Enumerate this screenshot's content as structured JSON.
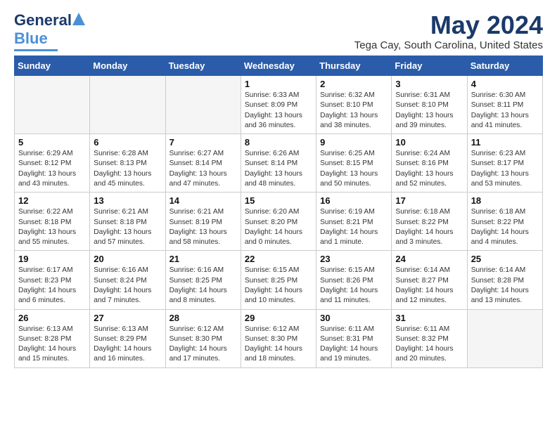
{
  "header": {
    "logo_general": "General",
    "logo_blue": "Blue",
    "month_title": "May 2024",
    "location": "Tega Cay, South Carolina, United States"
  },
  "days_of_week": [
    "Sunday",
    "Monday",
    "Tuesday",
    "Wednesday",
    "Thursday",
    "Friday",
    "Saturday"
  ],
  "weeks": [
    [
      {
        "day": "",
        "info": ""
      },
      {
        "day": "",
        "info": ""
      },
      {
        "day": "",
        "info": ""
      },
      {
        "day": "1",
        "info": "Sunrise: 6:33 AM\nSunset: 8:09 PM\nDaylight: 13 hours\nand 36 minutes."
      },
      {
        "day": "2",
        "info": "Sunrise: 6:32 AM\nSunset: 8:10 PM\nDaylight: 13 hours\nand 38 minutes."
      },
      {
        "day": "3",
        "info": "Sunrise: 6:31 AM\nSunset: 8:10 PM\nDaylight: 13 hours\nand 39 minutes."
      },
      {
        "day": "4",
        "info": "Sunrise: 6:30 AM\nSunset: 8:11 PM\nDaylight: 13 hours\nand 41 minutes."
      }
    ],
    [
      {
        "day": "5",
        "info": "Sunrise: 6:29 AM\nSunset: 8:12 PM\nDaylight: 13 hours\nand 43 minutes."
      },
      {
        "day": "6",
        "info": "Sunrise: 6:28 AM\nSunset: 8:13 PM\nDaylight: 13 hours\nand 45 minutes."
      },
      {
        "day": "7",
        "info": "Sunrise: 6:27 AM\nSunset: 8:14 PM\nDaylight: 13 hours\nand 47 minutes."
      },
      {
        "day": "8",
        "info": "Sunrise: 6:26 AM\nSunset: 8:14 PM\nDaylight: 13 hours\nand 48 minutes."
      },
      {
        "day": "9",
        "info": "Sunrise: 6:25 AM\nSunset: 8:15 PM\nDaylight: 13 hours\nand 50 minutes."
      },
      {
        "day": "10",
        "info": "Sunrise: 6:24 AM\nSunset: 8:16 PM\nDaylight: 13 hours\nand 52 minutes."
      },
      {
        "day": "11",
        "info": "Sunrise: 6:23 AM\nSunset: 8:17 PM\nDaylight: 13 hours\nand 53 minutes."
      }
    ],
    [
      {
        "day": "12",
        "info": "Sunrise: 6:22 AM\nSunset: 8:18 PM\nDaylight: 13 hours\nand 55 minutes."
      },
      {
        "day": "13",
        "info": "Sunrise: 6:21 AM\nSunset: 8:18 PM\nDaylight: 13 hours\nand 57 minutes."
      },
      {
        "day": "14",
        "info": "Sunrise: 6:21 AM\nSunset: 8:19 PM\nDaylight: 13 hours\nand 58 minutes."
      },
      {
        "day": "15",
        "info": "Sunrise: 6:20 AM\nSunset: 8:20 PM\nDaylight: 14 hours\nand 0 minutes."
      },
      {
        "day": "16",
        "info": "Sunrise: 6:19 AM\nSunset: 8:21 PM\nDaylight: 14 hours\nand 1 minute."
      },
      {
        "day": "17",
        "info": "Sunrise: 6:18 AM\nSunset: 8:22 PM\nDaylight: 14 hours\nand 3 minutes."
      },
      {
        "day": "18",
        "info": "Sunrise: 6:18 AM\nSunset: 8:22 PM\nDaylight: 14 hours\nand 4 minutes."
      }
    ],
    [
      {
        "day": "19",
        "info": "Sunrise: 6:17 AM\nSunset: 8:23 PM\nDaylight: 14 hours\nand 6 minutes."
      },
      {
        "day": "20",
        "info": "Sunrise: 6:16 AM\nSunset: 8:24 PM\nDaylight: 14 hours\nand 7 minutes."
      },
      {
        "day": "21",
        "info": "Sunrise: 6:16 AM\nSunset: 8:25 PM\nDaylight: 14 hours\nand 8 minutes."
      },
      {
        "day": "22",
        "info": "Sunrise: 6:15 AM\nSunset: 8:25 PM\nDaylight: 14 hours\nand 10 minutes."
      },
      {
        "day": "23",
        "info": "Sunrise: 6:15 AM\nSunset: 8:26 PM\nDaylight: 14 hours\nand 11 minutes."
      },
      {
        "day": "24",
        "info": "Sunrise: 6:14 AM\nSunset: 8:27 PM\nDaylight: 14 hours\nand 12 minutes."
      },
      {
        "day": "25",
        "info": "Sunrise: 6:14 AM\nSunset: 8:28 PM\nDaylight: 14 hours\nand 13 minutes."
      }
    ],
    [
      {
        "day": "26",
        "info": "Sunrise: 6:13 AM\nSunset: 8:28 PM\nDaylight: 14 hours\nand 15 minutes."
      },
      {
        "day": "27",
        "info": "Sunrise: 6:13 AM\nSunset: 8:29 PM\nDaylight: 14 hours\nand 16 minutes."
      },
      {
        "day": "28",
        "info": "Sunrise: 6:12 AM\nSunset: 8:30 PM\nDaylight: 14 hours\nand 17 minutes."
      },
      {
        "day": "29",
        "info": "Sunrise: 6:12 AM\nSunset: 8:30 PM\nDaylight: 14 hours\nand 18 minutes."
      },
      {
        "day": "30",
        "info": "Sunrise: 6:11 AM\nSunset: 8:31 PM\nDaylight: 14 hours\nand 19 minutes."
      },
      {
        "day": "31",
        "info": "Sunrise: 6:11 AM\nSunset: 8:32 PM\nDaylight: 14 hours\nand 20 minutes."
      },
      {
        "day": "",
        "info": ""
      }
    ]
  ]
}
